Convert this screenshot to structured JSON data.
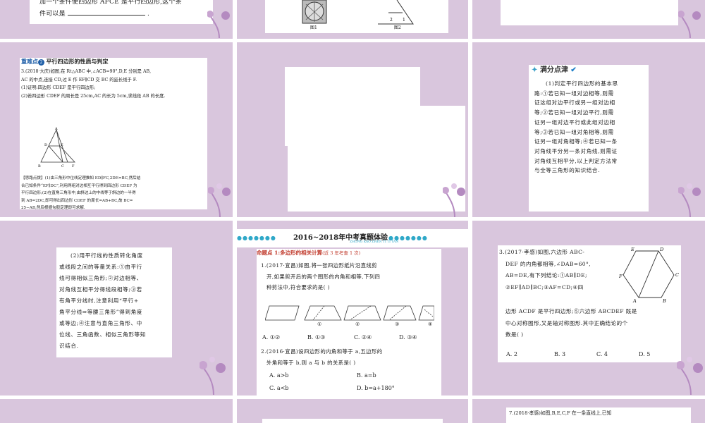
{
  "s1": {
    "line1": "加一个条件使四边形 AFCE 是平行四边形,这个条",
    "line2": "件可以是",
    "line2_end": "."
  },
  "s2": {
    "fig1": "图1",
    "fig2": "图2"
  },
  "s4": {
    "badge": "2",
    "heading_prefix": "重难点",
    "heading": "平行四边形的性质与判定",
    "q_lines": [
      "3.(2018·大庆)如图,在 Rt△ABC 中,∠ACB=90°,D,E 分别是 AB,",
      "AC 的中点,连接 CD,过 E 作 EF∥CD 交 BC 的延长线于 F.",
      "(1)证明:四边形 CDEF 是平行四边形;",
      "(2)若四边形 CDEF 的周长是 25cm,AC 的长为 5cm,求线段 AB 的长度."
    ],
    "fig_labels": {
      "A": "A",
      "D": "D",
      "E": "E",
      "B": "B",
      "C": "C",
      "F": "F"
    },
    "tip_lines": [
      "【思路点拨】(1)由三角形中位线定理推知 ED∥FC,2DE=BC,然后结",
      "合已知条件“EF∥DC”,利用两组对边相互平行得到四边形 CDEF 为",
      "平行四边形;(2)在直角三角形中,由斜边上的中线等于斜边的一半得",
      "到 AB=2DC,即可得出四边形 CDEF 的周长=AB+BC,故 BC=",
      "25−AB,然后根据勾股定理即可求解."
    ]
  },
  "s6": {
    "title": "满分点津",
    "lines": [
      "(1)判定平行四边形的基本思",
      "路:①若已知一组对边相等,则需",
      "证这组对边平行或另一组对边相",
      "等;②若已知一组对边平行,则需",
      "证另一组对边平行或此组对边相",
      "等;③若已知一组对角相等,则需",
      "证另一组对角相等;④若已知一条",
      "对角线平分另一条对角线,则需证",
      "对角线互相平分,以上判定方法常",
      "与全等三角形的知识结合."
    ]
  },
  "s7": {
    "lines": [
      "(2)用平行线的性质转化角度",
      "或线段之间的等量关系:①由平行",
      "线可得相似三角形;②对边相等、",
      "对角线互相平分得线段相等;③若",
      "有角平分线时,注意利用“平行+",
      "角平分线⇒等腰三角形”得到角度",
      "或等边;④注意与直角三角形、中",
      "位线、三角函数、相似三角形等知",
      "识结合."
    ]
  },
  "s8": {
    "banner": "2016~2018年中考真题体验",
    "banner_sub": "ZHONG KAO ZHEN TI TI YAN",
    "topic_prefix": "命题点 1:",
    "topic": "多边形的相关计算",
    "topic_note": "(近 3 年考查 1 次)",
    "q1": [
      "1.(2017·宜昌)如图,将一张四边形纸片沿直线剪",
      "开,如果剪开后的两个图形的内角和相等,下列四",
      "种剪法中,符合要求的是(    )"
    ],
    "q1_marks": [
      "①",
      "②",
      "③",
      "④"
    ],
    "q1_opts": [
      "A. ①②",
      "B. ①③",
      "C. ②④",
      "D. ③④"
    ],
    "q2": [
      "2.(2016·宜昌)设四边形的内角和等于 a,五边形的",
      "外角和等于 b,则 a 与 b 的关系是(    )"
    ],
    "q2_opts": [
      "A. a>b",
      "B. a=b",
      "C. a<b",
      "D. b=a+180°"
    ]
  },
  "s9": {
    "lines_top": [
      "3.(2017·孝感)如图,六边形 ABC-",
      "DEF 的内角都相等,∠DAB=60°,",
      "AB=DE,有下列结论:①AB∥DE;",
      "②EF∥AD∥BC;③AF=CD;④四"
    ],
    "lines_full": [
      "边形 ACDF 是平行四边形;⑤六边形 ABCDEF 既是",
      "中心对称图形,又是轴对称图形.其中正确结论的个",
      "数是(    )"
    ],
    "opts": [
      "A. 2",
      "B. 3",
      "C. 4",
      "D. 5"
    ],
    "hex_labels": {
      "E": "E",
      "D": "D",
      "F": "F",
      "C": "C",
      "A": "A",
      "B": "B"
    }
  },
  "s12": {
    "line1": "7.(2018·孝感)如图,B,E,C,F 在一条直线上,已知"
  }
}
